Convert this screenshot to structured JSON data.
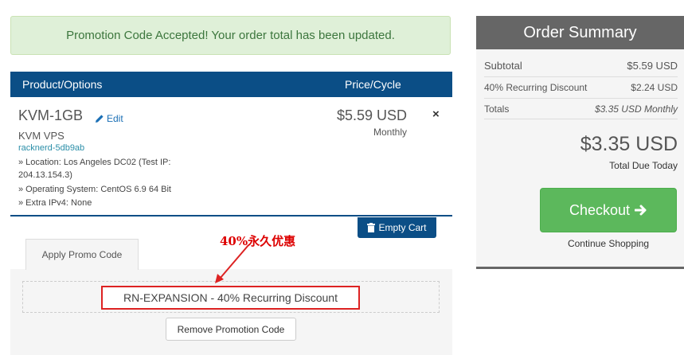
{
  "alert": {
    "message": "Promotion Code Accepted! Your order total has been updated."
  },
  "cart": {
    "headers": {
      "product": "Product/Options",
      "price": "Price/Cycle"
    },
    "item": {
      "name": "KVM-1GB",
      "edit": "Edit",
      "group": "KVM VPS",
      "domain": "racknerd-5db9ab",
      "options": [
        "» Location: Los Angeles DC02 (Test IP:",
        "204.13.154.3)",
        "» Operating System: CentOS 6.9 64 Bit",
        "» Extra IPv4: None"
      ],
      "price": "$5.59 USD",
      "cycle": "Monthly",
      "remove": "×"
    },
    "empty_cart": "Empty Cart"
  },
  "promo": {
    "tab": "Apply Promo Code",
    "applied": "RN-EXPANSION - 40% Recurring Discount",
    "remove": "Remove Promotion Code",
    "annotation": "40%永久优惠"
  },
  "summary": {
    "title": "Order Summary",
    "rows": [
      {
        "label": "Subtotal",
        "value": "$5.59 USD"
      },
      {
        "label": "40% Recurring Discount",
        "value": "$2.24 USD"
      },
      {
        "label": "Totals",
        "value": "$3.35 USD Monthly"
      }
    ],
    "total": "$3.35 USD",
    "total_label": "Total Due Today",
    "checkout": "Checkout",
    "continue": "Continue Shopping"
  },
  "colors": {
    "header_blue": "#0b4e86",
    "alert_green": "#dff0d8",
    "checkout_green": "#5cb85c",
    "annotation_red": "#d22"
  }
}
